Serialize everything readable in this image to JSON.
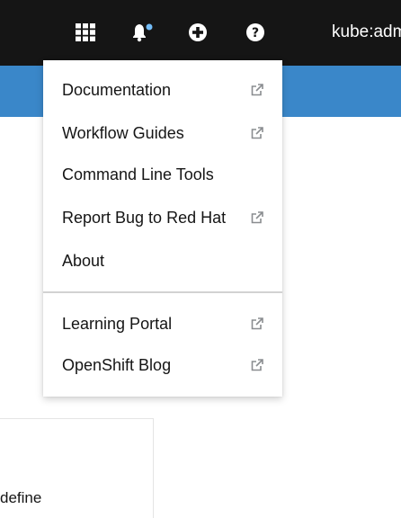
{
  "masthead": {
    "icons": [
      "app-launcher-icon",
      "notifications-icon",
      "quick-create-icon",
      "help-icon"
    ],
    "notification_dot_color": "#73bcf7",
    "user_label": "kube:admin"
  },
  "help_menu": {
    "primary_items": [
      {
        "label": "Documentation",
        "external": true
      },
      {
        "label": "Workflow Guides",
        "external": true
      },
      {
        "label": "Command Line Tools",
        "external": false
      },
      {
        "label": "Report Bug to Red Hat",
        "external": true
      },
      {
        "label": "About",
        "external": false
      }
    ],
    "secondary_items": [
      {
        "label": "Learning Portal",
        "external": true
      },
      {
        "label": "OpenShift Blog",
        "external": true
      }
    ]
  },
  "background": {
    "partial_text": "define"
  },
  "colors": {
    "masthead": "#151515",
    "accent_blue": "#3a87c9"
  }
}
